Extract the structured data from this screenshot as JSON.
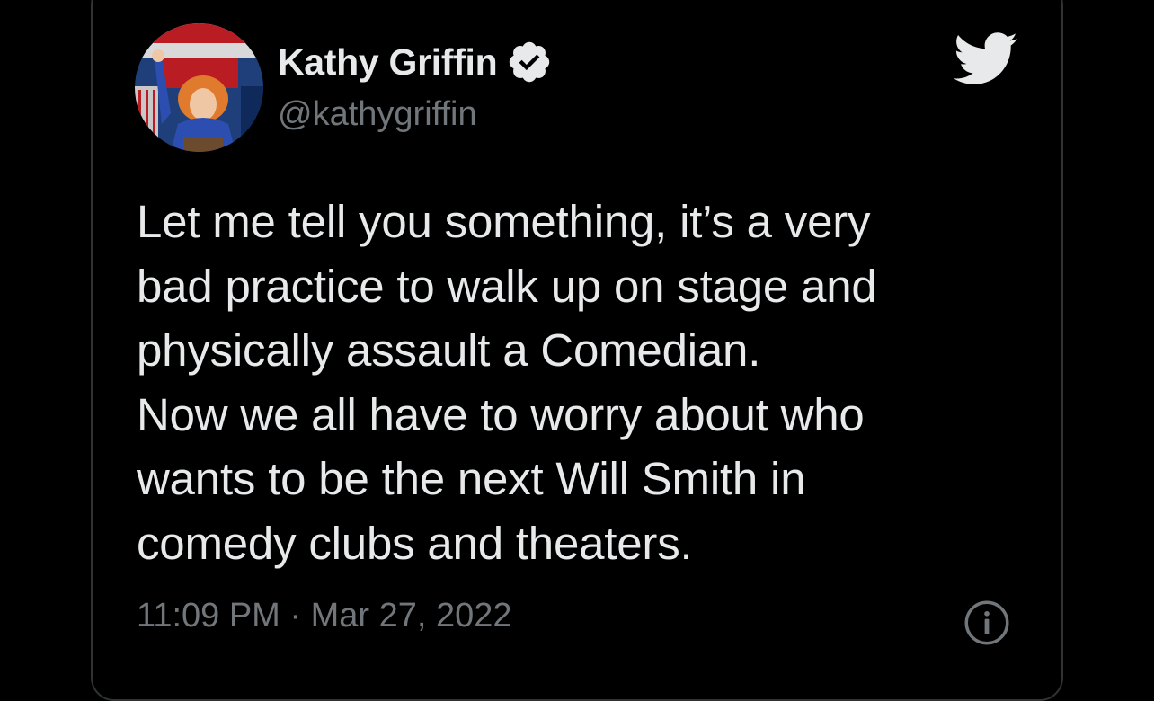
{
  "tweet": {
    "author": {
      "display_name": "Kathy Griffin",
      "handle": "@kathygriffin",
      "verified": true,
      "avatar_icon": "profile-photo"
    },
    "text_lines": [
      "Let me tell you something, it’s a very",
      "bad practice to walk up on stage and",
      "physically assault a Comedian.",
      "Now we all have to worry about who",
      "wants to be the next Will Smith in",
      "comedy clubs and theaters."
    ],
    "timestamp": "11:09 PM · Mar 27, 2022",
    "platform_icon": "twitter-bird-icon",
    "info_icon": "info-icon"
  },
  "colors": {
    "background": "#000000",
    "border": "#2f3336",
    "primary_text": "#e7e9ea",
    "secondary_text": "#71767b",
    "verified_badge": "#e7e9ea"
  }
}
